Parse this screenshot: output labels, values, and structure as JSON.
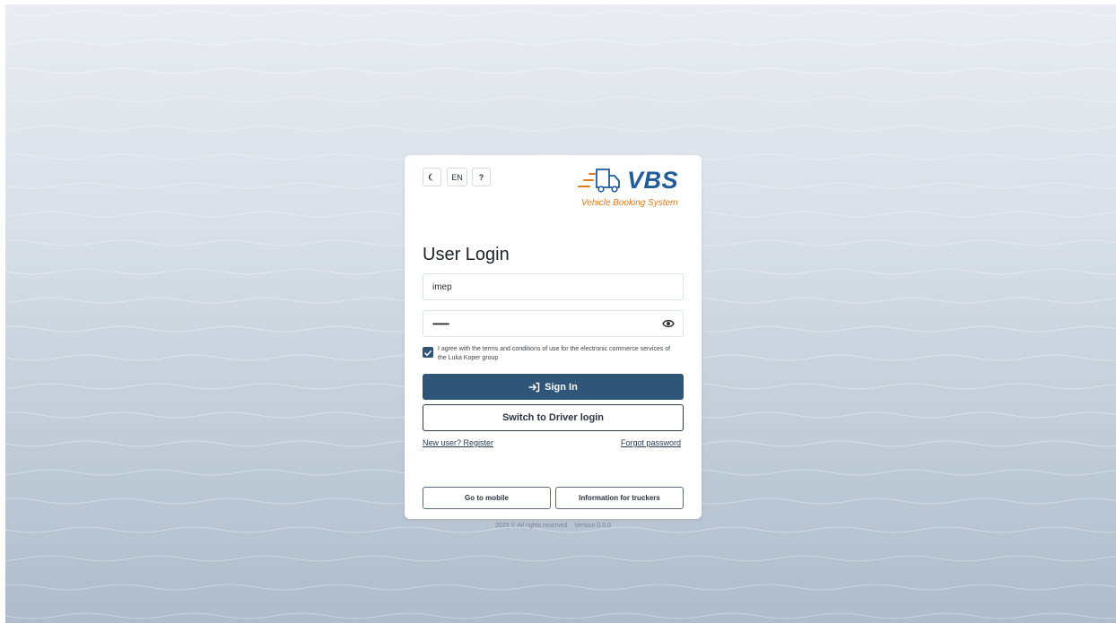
{
  "toolbar": {
    "theme_icon": "moon-icon",
    "language": "EN",
    "help": "?"
  },
  "logo": {
    "brand": "VBS",
    "subtitle": "Vehicle Booking System",
    "icon": "truck-icon"
  },
  "login": {
    "title": "User Login",
    "username_value": "imep",
    "password_value": "••••••••••",
    "password_toggle_icon": "eye-icon",
    "terms_checked": true,
    "terms_text": "I agree with the terms and conditions of use for the electronic commerce services of the Luka Koper group",
    "sign_in_label": "Sign In",
    "sign_in_icon": "login-arrow-icon",
    "switch_label": "Switch to Driver login",
    "register_link": "New user? Register",
    "forgot_link": "Forgot password",
    "mobile_button": "Go to mobile",
    "truckers_button": "Information for truckers"
  },
  "footer": {
    "copyright": "2025 © All rights reserved",
    "version": "Version 0.0.0"
  },
  "colors": {
    "primary": "#2f5579",
    "brand_blue": "#1f5c99",
    "brand_orange": "#e07a1f"
  }
}
